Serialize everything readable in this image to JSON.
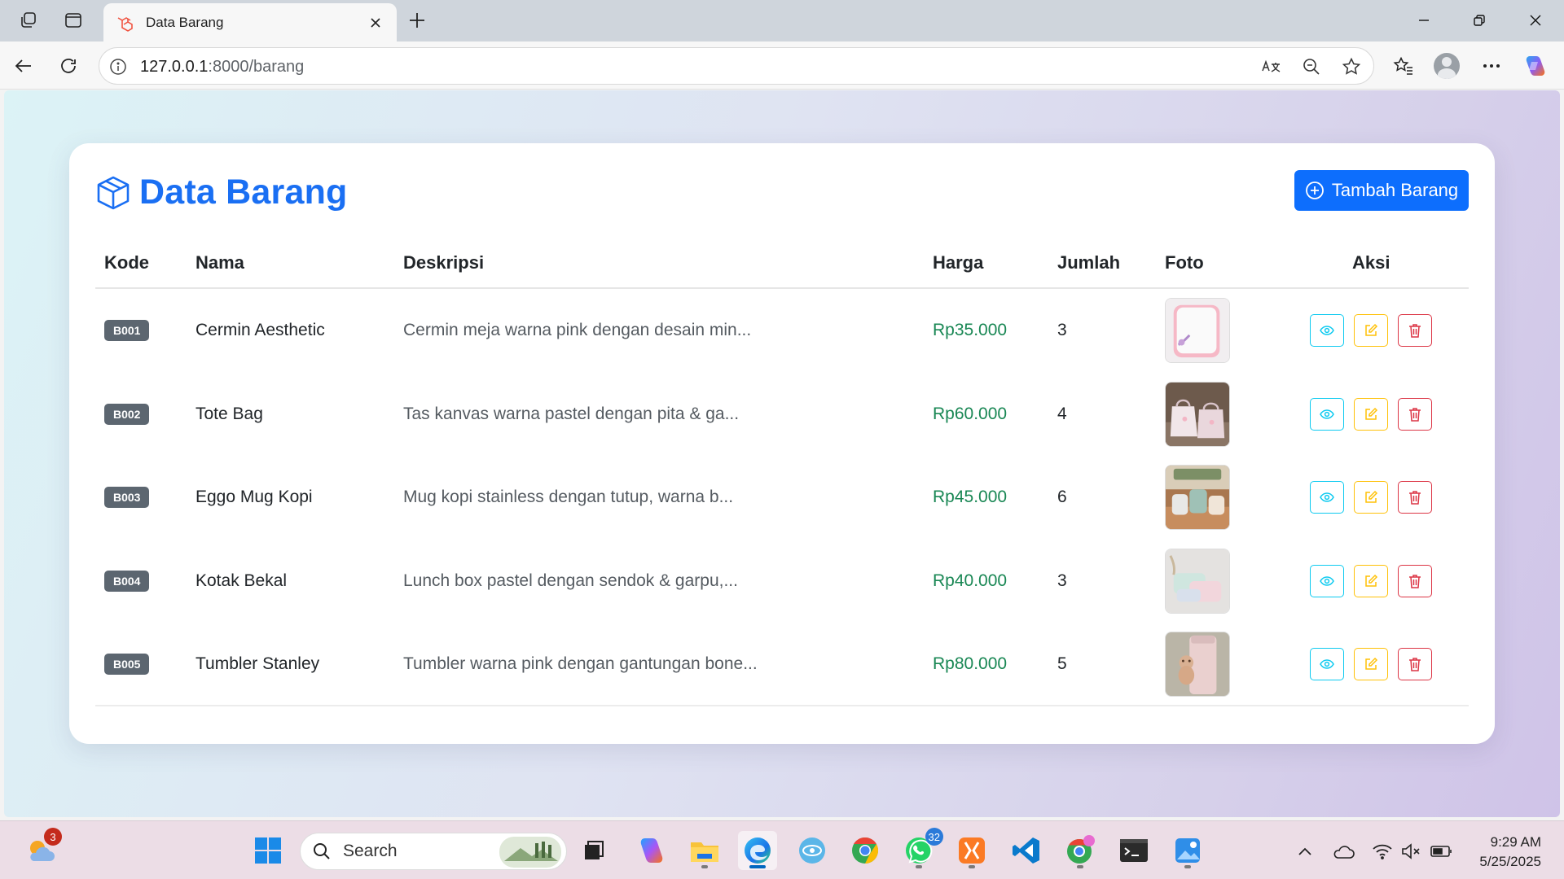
{
  "browser": {
    "tab_title": "Data Barang",
    "url_host": "127.0.0.1",
    "url_rest": ":8000/barang"
  },
  "page": {
    "title": "Data Barang",
    "add_button": "Tambah Barang",
    "title_color": "#1a6ff3",
    "accent": "#0d6efd"
  },
  "table": {
    "headers": {
      "kode": "Kode",
      "nama": "Nama",
      "deskripsi": "Deskripsi",
      "harga": "Harga",
      "jumlah": "Jumlah",
      "foto": "Foto",
      "aksi": "Aksi"
    },
    "rows": [
      {
        "kode": "B001",
        "nama": "Cermin Aesthetic",
        "deskripsi": "Cermin meja warna pink dengan desain min...",
        "harga": "Rp35.000",
        "jumlah": "3",
        "foto": "mirror-photo"
      },
      {
        "kode": "B002",
        "nama": "Tote Bag",
        "deskripsi": "Tas kanvas warna pastel dengan pita & ga...",
        "harga": "Rp60.000",
        "jumlah": "4",
        "foto": "tote-bag-photo"
      },
      {
        "kode": "B003",
        "nama": "Eggo Mug Kopi",
        "deskripsi": "Mug kopi stainless dengan tutup, warna b...",
        "harga": "Rp45.000",
        "jumlah": "6",
        "foto": "mug-photo"
      },
      {
        "kode": "B004",
        "nama": "Kotak Bekal",
        "deskripsi": "Lunch box pastel dengan sendok & garpu,...",
        "harga": "Rp40.000",
        "jumlah": "3",
        "foto": "lunch-box-photo"
      },
      {
        "kode": "B005",
        "nama": "Tumbler Stanley",
        "deskripsi": "Tumbler warna pink dengan gantungan bone...",
        "harga": "Rp80.000",
        "jumlah": "5",
        "foto": "tumbler-photo"
      }
    ]
  },
  "taskbar": {
    "search_label": "Search",
    "weather_badge": "3",
    "whatsapp_badge": "32",
    "time": "9:29 AM",
    "date": "5/25/2025"
  }
}
